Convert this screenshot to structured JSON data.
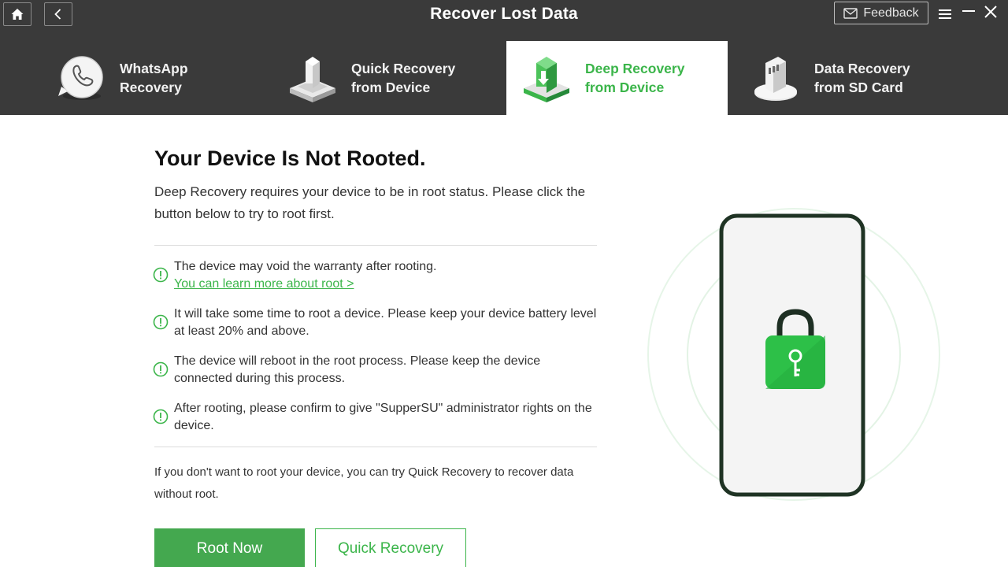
{
  "window": {
    "title": "Recover Lost Data",
    "feedback_label": "Feedback"
  },
  "icons": {
    "home": "home-icon",
    "back": "chevron-left-icon",
    "feedback": "mail-icon",
    "menu": "hamburger-menu-icon",
    "minimize": "minimize-icon",
    "close": "close-icon",
    "warning": "exclamation-circle-icon",
    "lock": "lock-key-icon"
  },
  "tabs": [
    {
      "label": "WhatsApp\nRecovery",
      "icon": "whatsapp-phone-icon",
      "active": false
    },
    {
      "label": "Quick Recovery\nfrom Device",
      "icon": "quick-recovery-icon",
      "active": false
    },
    {
      "label": "Deep Recovery\nfrom Device",
      "icon": "deep-recovery-icon",
      "active": true
    },
    {
      "label": "Data Recovery\nfrom SD Card",
      "icon": "sd-card-icon",
      "active": false
    }
  ],
  "content": {
    "heading": "Your Device Is Not Rooted.",
    "intro": "Deep Recovery requires your device to be in root status. Please click the button below to try to root first.",
    "notes": [
      {
        "text": "The device may void the warranty after rooting.",
        "link": "You can learn more about root >"
      },
      {
        "text": "It will take some time to root a device. Please keep your device battery level at least 20% and above."
      },
      {
        "text": "The device will reboot in the root process. Please keep the device connected during this process."
      },
      {
        "text": "After rooting, please confirm to give \"SupperSU\" administrator rights on the device."
      }
    ],
    "footnote": "If you don't want to root your device, you can try Quick Recovery to recover data without root."
  },
  "buttons": {
    "root_now": "Root Now",
    "quick_recovery": "Quick Recovery"
  },
  "colors": {
    "accent": "#3bb54a",
    "primary_button": "#44a84f",
    "header_bg": "#3a3a3a"
  }
}
